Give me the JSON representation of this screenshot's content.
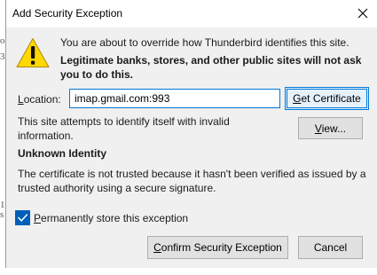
{
  "window": {
    "title": "Add Security Exception"
  },
  "background": {
    "edge_glyphs": [
      "o",
      "3",
      "1",
      "s"
    ]
  },
  "message": {
    "line1": "You are about to override how Thunderbird identifies this site.",
    "line2": "Legitimate banks, stores, and other public sites will not ask you to do this."
  },
  "location": {
    "label_pre": "",
    "label_key": "L",
    "label_post": "ocation:",
    "value": "imap.gmail.com:993"
  },
  "buttons": {
    "get_certificate": {
      "pre": "",
      "key": "G",
      "post": "et Certificate"
    },
    "view": {
      "pre": "",
      "key": "V",
      "post": "iew..."
    },
    "confirm": {
      "pre": "",
      "key": "C",
      "post": "onfirm Security Exception"
    },
    "cancel": "Cancel"
  },
  "site_status": "This site attempts to identify itself with invalid information.",
  "identity": {
    "heading": "Unknown Identity",
    "text": "The certificate is not trusted because it hasn't been verified as issued by a trusted authority using a secure signature."
  },
  "permanent": {
    "checked": true,
    "pre": "",
    "key": "P",
    "post": "ermanently store this exception"
  },
  "colors": {
    "accent": "#0078d7",
    "checkbox": "#005fb8",
    "warning_yellow": "#ffd800",
    "dialog_bg": "#f0f0f0"
  },
  "icons": {
    "warning": "warning-triangle-icon",
    "close": "close-icon",
    "check": "checkmark-icon"
  }
}
